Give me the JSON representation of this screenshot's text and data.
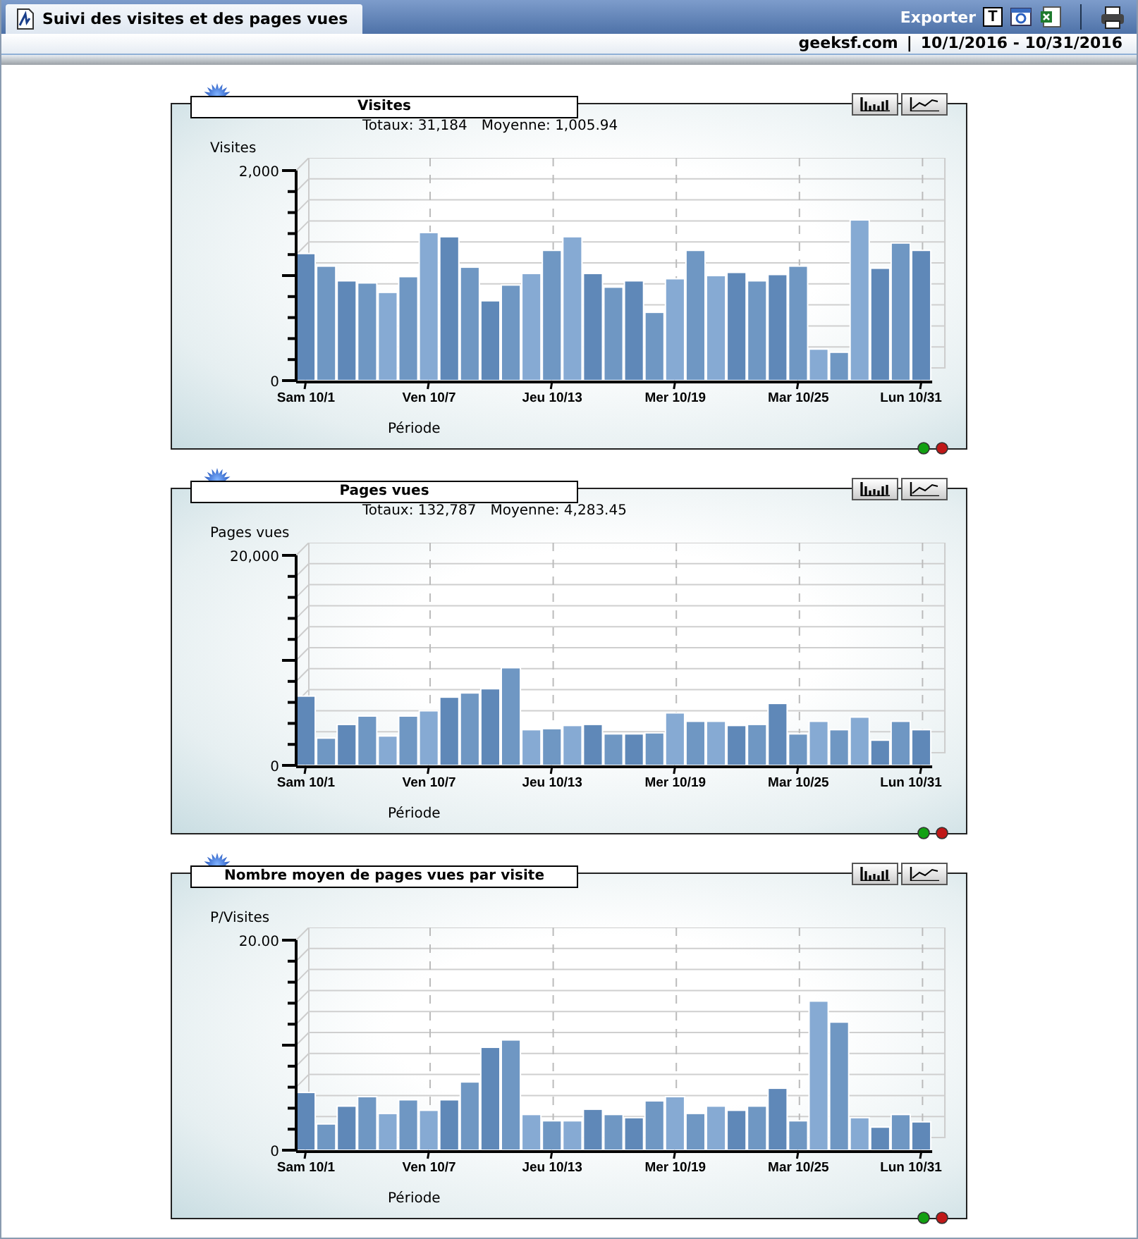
{
  "header": {
    "tab": "Suivi des visites et des pages vues",
    "export_label": "Exporter",
    "text_export_key": "T"
  },
  "subheader": {
    "site": "geeksf.com",
    "separator": "|",
    "date_range": "10/1/2016 - 10/31/2016"
  },
  "panels": [
    {
      "title": "Visites",
      "totals": "Totaux: 31,184",
      "average": "Moyenne: 1,005.94",
      "chart_data": {
        "type": "bar",
        "ylabel": "Visites",
        "xlabel": "Période",
        "categories": [
          "Sam 10/1",
          null,
          null,
          null,
          null,
          null,
          "Ven 10/7",
          null,
          null,
          null,
          null,
          null,
          "Jeu 10/13",
          null,
          null,
          null,
          null,
          null,
          "Mer 10/19",
          null,
          null,
          null,
          null,
          null,
          "Mar 10/25",
          null,
          null,
          null,
          null,
          null,
          "Lun 10/31"
        ],
        "values": [
          1210,
          1090,
          950,
          930,
          840,
          990,
          1410,
          1370,
          1080,
          760,
          910,
          1020,
          1240,
          1370,
          1020,
          890,
          950,
          650,
          970,
          1240,
          1000,
          1030,
          950,
          1010,
          1090,
          300,
          270,
          1530,
          1070,
          1310,
          1240
        ],
        "ylim": [
          0,
          2000
        ],
        "grid": true,
        "yticks": [
          {
            "value": 0,
            "label": "0"
          },
          {
            "value": 2000,
            "label": "2,000"
          }
        ]
      }
    },
    {
      "title": "Pages vues",
      "totals": "Totaux: 132,787",
      "average": "Moyenne: 4,283.45",
      "chart_data": {
        "type": "bar",
        "ylabel": "Pages vues",
        "xlabel": "Période",
        "categories": [
          "Sam 10/1",
          null,
          null,
          null,
          null,
          null,
          "Ven 10/7",
          null,
          null,
          null,
          null,
          null,
          "Jeu 10/13",
          null,
          null,
          null,
          null,
          null,
          "Mer 10/19",
          null,
          null,
          null,
          null,
          null,
          "Mar 10/25",
          null,
          null,
          null,
          null,
          null,
          "Lun 10/31"
        ],
        "values": [
          6600,
          2600,
          3900,
          4700,
          2800,
          4700,
          5200,
          6500,
          6900,
          7300,
          9300,
          3400,
          3500,
          3800,
          3900,
          3000,
          3000,
          3100,
          5000,
          4200,
          4200,
          3800,
          3900,
          5900,
          3000,
          4200,
          3400,
          4600,
          2400,
          4200,
          3400
        ],
        "ylim": [
          0,
          20000
        ],
        "grid": true,
        "yticks": [
          {
            "value": 0,
            "label": "0"
          },
          {
            "value": 20000,
            "label": "20,000"
          }
        ]
      }
    },
    {
      "title": "Nombre moyen de pages vues par visite",
      "chart_data": {
        "type": "bar",
        "ylabel": "P/Visites",
        "xlabel": "Période",
        "categories": [
          "Sam 10/1",
          null,
          null,
          null,
          null,
          null,
          "Ven 10/7",
          null,
          null,
          null,
          null,
          null,
          "Jeu 10/13",
          null,
          null,
          null,
          null,
          null,
          "Mer 10/19",
          null,
          null,
          null,
          null,
          null,
          "Mar 10/25",
          null,
          null,
          null,
          null,
          null,
          "Lun 10/31"
        ],
        "values": [
          5.5,
          2.5,
          4.2,
          5.1,
          3.5,
          4.8,
          3.8,
          4.8,
          6.5,
          9.8,
          10.5,
          3.4,
          2.8,
          2.8,
          3.9,
          3.4,
          3.1,
          4.7,
          5.1,
          3.5,
          4.2,
          3.8,
          4.2,
          5.9,
          2.8,
          14.2,
          12.2,
          3.1,
          2.2,
          3.4,
          2.7
        ],
        "ylim": [
          0,
          20
        ],
        "grid": true,
        "yticks": [
          {
            "value": 0,
            "label": "0"
          },
          {
            "value": 20,
            "label": "20.00"
          }
        ]
      }
    }
  ]
}
